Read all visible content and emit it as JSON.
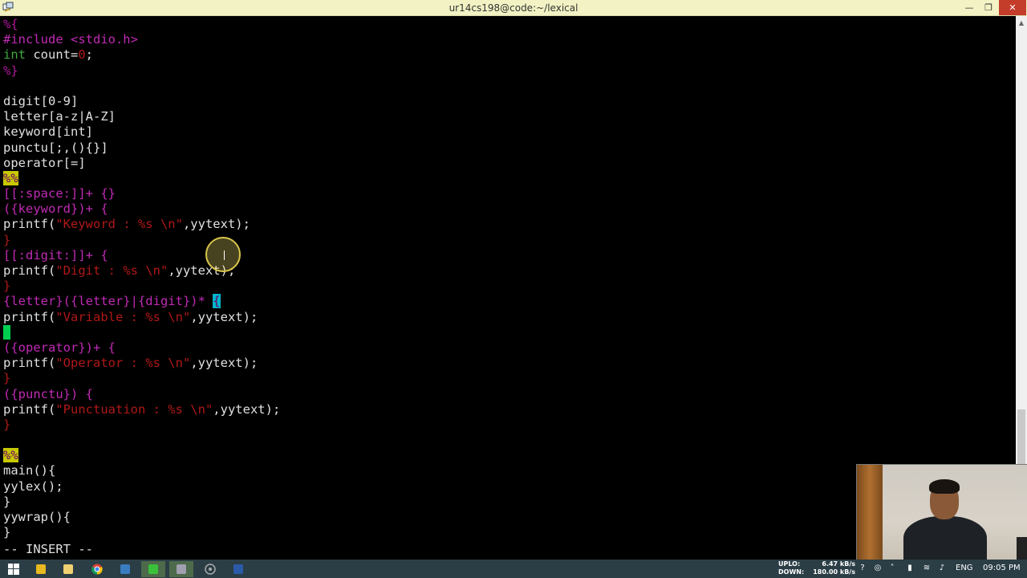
{
  "window": {
    "title": "ur14cs198@code:~/lexical",
    "buttons": {
      "minimize": "—",
      "maximize": "❐",
      "close": "✕"
    }
  },
  "code_lines": [
    [
      {
        "t": "%{",
        "c": "c-pct"
      }
    ],
    [
      {
        "t": "#include <stdio.h>",
        "c": "c-magenta"
      }
    ],
    [
      {
        "t": "int",
        "c": "c-type"
      },
      {
        "t": " count=",
        "c": "c-white"
      },
      {
        "t": "0",
        "c": "c-red"
      },
      {
        "t": ";",
        "c": "c-white"
      }
    ],
    [
      {
        "t": "%}",
        "c": "c-pct"
      }
    ],
    [
      {
        "t": "",
        "c": "c-white"
      }
    ],
    [
      {
        "t": "digit[0-9]",
        "c": "c-white"
      }
    ],
    [
      {
        "t": "letter[a-z|A-Z]",
        "c": "c-white"
      }
    ],
    [
      {
        "t": "keyword[int]",
        "c": "c-white"
      }
    ],
    [
      {
        "t": "punctu[;,(){}]",
        "c": "c-white"
      }
    ],
    [
      {
        "t": "operator[=]",
        "c": "c-white"
      }
    ],
    [
      {
        "t": "%%",
        "c": "hl-yellow"
      }
    ],
    [
      {
        "t": "[[:space:]]+ {}",
        "c": "c-magenta"
      }
    ],
    [
      {
        "t": "({keyword})+ {",
        "c": "c-magenta"
      }
    ],
    [
      {
        "t": "printf(",
        "c": "c-white"
      },
      {
        "t": "\"Keyword : %s \\n\"",
        "c": "c-str"
      },
      {
        "t": ",yytext);",
        "c": "c-white"
      }
    ],
    [
      {
        "t": "}",
        "c": "c-red"
      }
    ],
    [
      {
        "t": "[[:digit:]]+ {",
        "c": "c-magenta"
      }
    ],
    [
      {
        "t": "printf(",
        "c": "c-white"
      },
      {
        "t": "\"Digit : %s \\n\"",
        "c": "c-str"
      },
      {
        "t": ",yytext);",
        "c": "c-white"
      }
    ],
    [
      {
        "t": "}",
        "c": "c-red"
      }
    ],
    [
      {
        "t": "{letter}({letter}|{digit})* ",
        "c": "c-magenta"
      },
      {
        "t": "{",
        "c": "hl-cyan"
      }
    ],
    [
      {
        "t": "printf(",
        "c": "c-white"
      },
      {
        "t": "\"Variable : %s \\n\"",
        "c": "c-str"
      },
      {
        "t": ",yytext);",
        "c": "c-white"
      }
    ],
    [
      {
        "t": "}",
        "c": "hl-green"
      }
    ],
    [
      {
        "t": "({operator})+ {",
        "c": "c-magenta"
      }
    ],
    [
      {
        "t": "printf(",
        "c": "c-white"
      },
      {
        "t": "\"Operator : %s \\n\"",
        "c": "c-str"
      },
      {
        "t": ",yytext);",
        "c": "c-white"
      }
    ],
    [
      {
        "t": "}",
        "c": "c-red"
      }
    ],
    [
      {
        "t": "({punctu}) {",
        "c": "c-magenta"
      }
    ],
    [
      {
        "t": "printf(",
        "c": "c-white"
      },
      {
        "t": "\"Punctuation : %s \\n\"",
        "c": "c-str"
      },
      {
        "t": ",yytext);",
        "c": "c-white"
      }
    ],
    [
      {
        "t": "}",
        "c": "c-red"
      }
    ],
    [
      {
        "t": "",
        "c": "c-white"
      }
    ],
    [
      {
        "t": "%%",
        "c": "hl-yellow"
      }
    ],
    [
      {
        "t": "main(){",
        "c": "c-white"
      }
    ],
    [
      {
        "t": "yylex();",
        "c": "c-white"
      }
    ],
    [
      {
        "t": "}",
        "c": "c-white"
      }
    ],
    [
      {
        "t": "yywrap(){",
        "c": "c-white"
      }
    ],
    [
      {
        "t": "}",
        "c": "c-white"
      }
    ]
  ],
  "status_line": "-- INSERT --",
  "taskbar": {
    "items": [
      "windows-start-icon",
      "file-explorer-icon",
      "folder-icon",
      "chrome-icon",
      "virtualbox-icon",
      "putty-icon",
      "network-tool-icon",
      "media-icon",
      "word-icon"
    ],
    "network": {
      "up_label": "UPLO:",
      "up_value": "6.47 kB/s",
      "down_label": "DOWN:",
      "down_value": "180.00 kB/s"
    },
    "language": "ENG",
    "clock": "09:05 PM"
  },
  "colors": {
    "title_bar": "#f2f2c4",
    "terminal_bg": "#000000",
    "taskbar_bg": "#2b3e46",
    "close_button": "#c43c2a"
  }
}
